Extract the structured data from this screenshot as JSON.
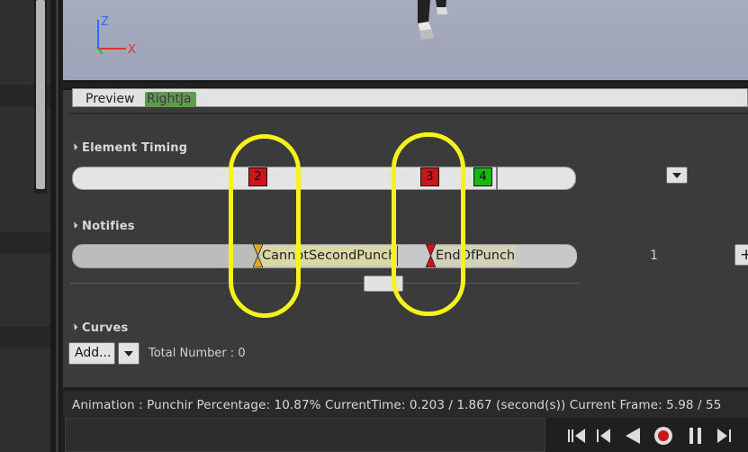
{
  "viewport": {
    "axes": {
      "z": "Z",
      "x": "X"
    },
    "icons": [
      "axis-gizmo-icon"
    ]
  },
  "preview": {
    "label": "Preview",
    "chip": "RightJa"
  },
  "element_timing": {
    "title": "Element Timing",
    "markers": [
      {
        "label": "2",
        "color": "#c8161a"
      },
      {
        "label": "3",
        "color": "#c8161a"
      },
      {
        "label": "4",
        "color": "#14b714"
      }
    ]
  },
  "notifies": {
    "title": "Notifies",
    "items": [
      {
        "label": "CannotSecondPunch",
        "pin_color": "#e2a62a"
      },
      {
        "label": "EndOfPunch",
        "pin_color": "#c8161a"
      }
    ],
    "track_count": "1",
    "add_label": "+"
  },
  "curves": {
    "title": "Curves",
    "add_label": "Add...",
    "total_label": "Total Number : 0"
  },
  "status": {
    "text": "Animation :  Punchir Percentage:  10.87% CurrentTime:  0.203 / 1.867 (second(s)) Current Frame:  5.98 / 55"
  },
  "transport": {
    "buttons": [
      "to-start",
      "step-back",
      "play-reverse",
      "record",
      "pause",
      "step-forward"
    ]
  },
  "highlight_color": "#f5f31b"
}
